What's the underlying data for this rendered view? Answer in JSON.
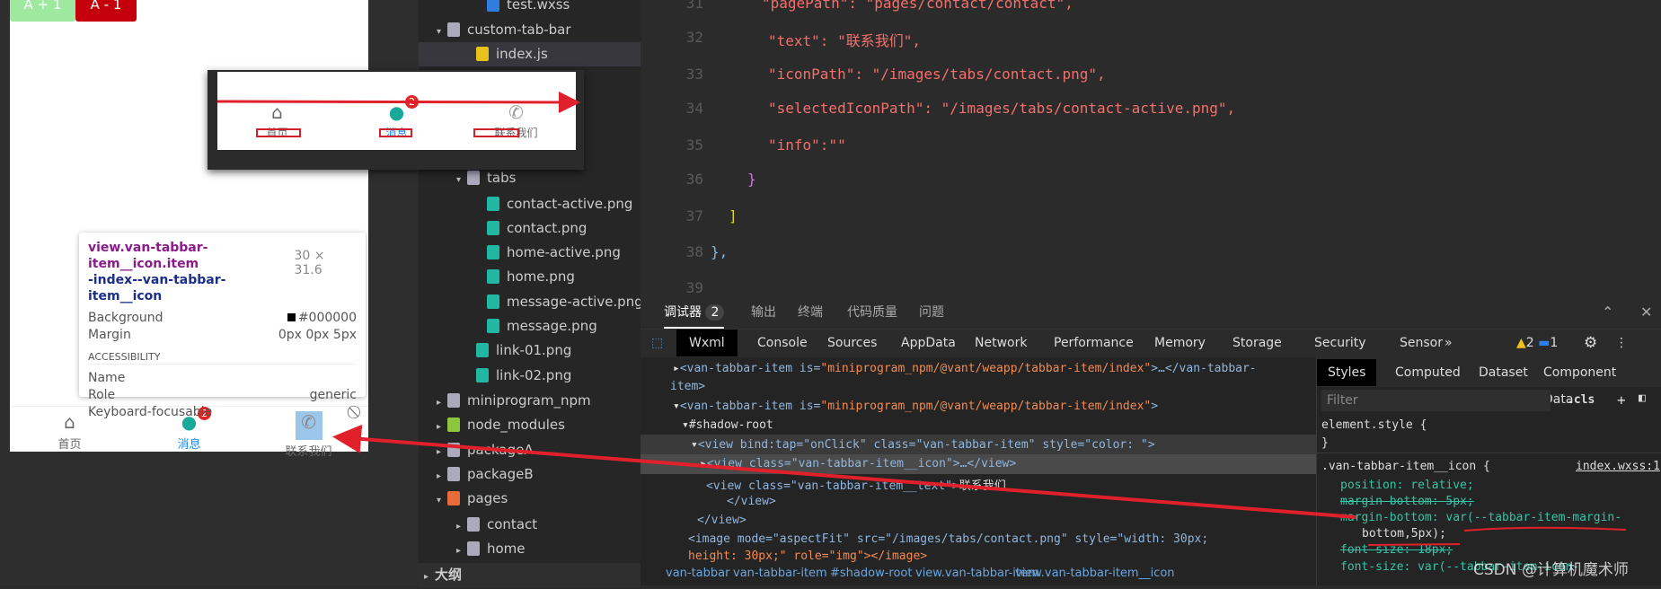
{
  "simulator": {
    "btn_inc": "A + 1",
    "btn_dec": "A - 1",
    "tabs": [
      {
        "label": "首页",
        "icon": "home-icon"
      },
      {
        "label": "消息",
        "icon": "message-icon",
        "badge": "2"
      },
      {
        "label": "联系我们",
        "icon": "phone-icon"
      }
    ],
    "tooltip": {
      "selector_a": "view.van-tabbar-item__icon.item",
      "selector_b": "-index--van-tabbar-item__icon",
      "size": "30 × 31.6",
      "background_label": "Background",
      "background_value": "#000000",
      "margin_label": "Margin",
      "margin_value": "0px 0px 5px",
      "accessibility": "ACCESSIBILITY",
      "name_label": "Name",
      "role_label": "Role",
      "role_value": "generic",
      "focusable_label": "Keyboard-focusable"
    }
  },
  "overlay": {
    "tabs": [
      "首页",
      "消息",
      "联系我们"
    ],
    "badge": "2"
  },
  "file_tree": [
    {
      "label": "test.wxss",
      "type": "wxss"
    },
    {
      "label": "custom-tab-bar",
      "type": "folder-open"
    },
    {
      "label": "index.js",
      "type": "js",
      "selected": true
    },
    {
      "label": "tabs",
      "type": "folder-open"
    },
    {
      "label": "contact-active.png",
      "type": "image"
    },
    {
      "label": "contact.png",
      "type": "image"
    },
    {
      "label": "home-active.png",
      "type": "image"
    },
    {
      "label": "home.png",
      "type": "image"
    },
    {
      "label": "message-active.png",
      "type": "image"
    },
    {
      "label": "message.png",
      "type": "image"
    },
    {
      "label": "link-01.png",
      "type": "image"
    },
    {
      "label": "link-02.png",
      "type": "image"
    },
    {
      "label": "miniprogram_npm",
      "type": "folder"
    },
    {
      "label": "node_modules",
      "type": "folder-node"
    },
    {
      "label": "packageA",
      "type": "folder"
    },
    {
      "label": "packageB",
      "type": "folder"
    },
    {
      "label": "pages",
      "type": "folder-pages"
    },
    {
      "label": "contact",
      "type": "folder"
    },
    {
      "label": "home",
      "type": "folder"
    },
    {
      "label": "大纲",
      "type": "section"
    }
  ],
  "editor": {
    "lines": [
      {
        "n": "31",
        "code": "\"pagePath\": \"pages/contact/contact\","
      },
      {
        "n": "32",
        "code": "\"text\": \"联系我们\","
      },
      {
        "n": "33",
        "code": "\"iconPath\": \"/images/tabs/contact.png\","
      },
      {
        "n": "34",
        "code": "\"selectedIconPath\": \"/images/tabs/contact-active.png\","
      },
      {
        "n": "35",
        "code": "\"info\":\"\""
      },
      {
        "n": "36",
        "code": "}"
      },
      {
        "n": "37",
        "code": "]"
      },
      {
        "n": "38",
        "code": "},"
      },
      {
        "n": "39",
        "code": ""
      }
    ]
  },
  "devtools": {
    "top_tabs": [
      "调试器",
      "输出",
      "终端",
      "代码质量",
      "问题"
    ],
    "debugger_count": "2",
    "panels": [
      "Wxml",
      "Console",
      "Sources",
      "AppData",
      "Network",
      "Performance",
      "Memory",
      "Storage",
      "Security",
      "Sensor"
    ],
    "more": "»",
    "warnings": "2",
    "infos": "1",
    "wxml": {
      "l1a": "<van-tabbar-item is=",
      "l1s": "\"miniprogram_npm/@vant/weapp/tabbar-item/index\"",
      "l1b": ">…</van-tabbar-",
      "l1c": "item>",
      "l2a": "<van-tabbar-item is=",
      "l2s": "\"miniprogram_npm/@vant/weapp/tabbar-item/index\"",
      "l2b": ">",
      "l3": "#shadow-root",
      "l4": "<view bind:tap=\"onClick\" class=\"van-tabbar-item\" style=\"color: \">",
      "l5": "<view class=\"van-tabbar-item__icon\">…</view>",
      "l6a": "<view class=\"van-tabbar-item__text\">",
      "l6t": "联系我们",
      "l7": "</view>",
      "l8": "</view>",
      "l9": "<image mode=\"aspectFit\" src=\"/images/tabs/contact.png\" style=\"width: 30px;",
      "l10": "height: 30px;\" role=\"img\"></image>"
    },
    "breadcrumb": [
      "van-tabbar",
      "van-tabbar-item",
      "#shadow-root",
      "view.van-tabbar-item",
      "view.van-tabbar-item__icon"
    ],
    "styles": {
      "tabs": [
        "Styles",
        "Computed",
        "Dataset",
        "Component Data"
      ],
      "filter_placeholder": "Filter",
      "cls": ".cls",
      "element_style": "element.style {",
      "close_brace": "}",
      "rule": ".van-tabbar-item__icon {",
      "source": "index.wxss:1",
      "decl1": "position: relative;",
      "decl2": "margin-bottom: 5px;",
      "decl3": "margin-bottom: var(--tabbar-item-margin-",
      "decl3b": "bottom,5px);",
      "decl4": "font-size: 18px;",
      "decl5": "font-size: var(--tabbar-item-icon-"
    }
  },
  "watermark": "CSDN @计算机魔术师",
  "colors": {
    "annotation_red": "#e0202a",
    "active_tab": "#1989fa",
    "badge": "#ee0a24"
  }
}
